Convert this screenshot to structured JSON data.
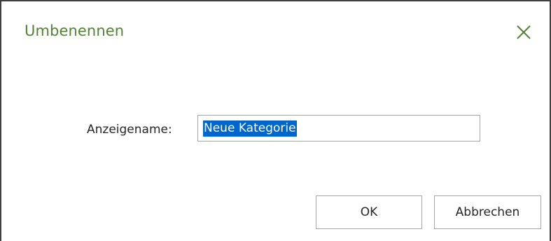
{
  "dialog": {
    "title": "Umbenennen",
    "close_icon": "close-icon",
    "accent_color": "#538135"
  },
  "form": {
    "label": "Anzeigename:",
    "value": "Neue Kategorie",
    "value_selected": true,
    "selection_color": "#0066cc"
  },
  "buttons": {
    "ok_label": "OK",
    "cancel_label": "Abbrechen"
  }
}
